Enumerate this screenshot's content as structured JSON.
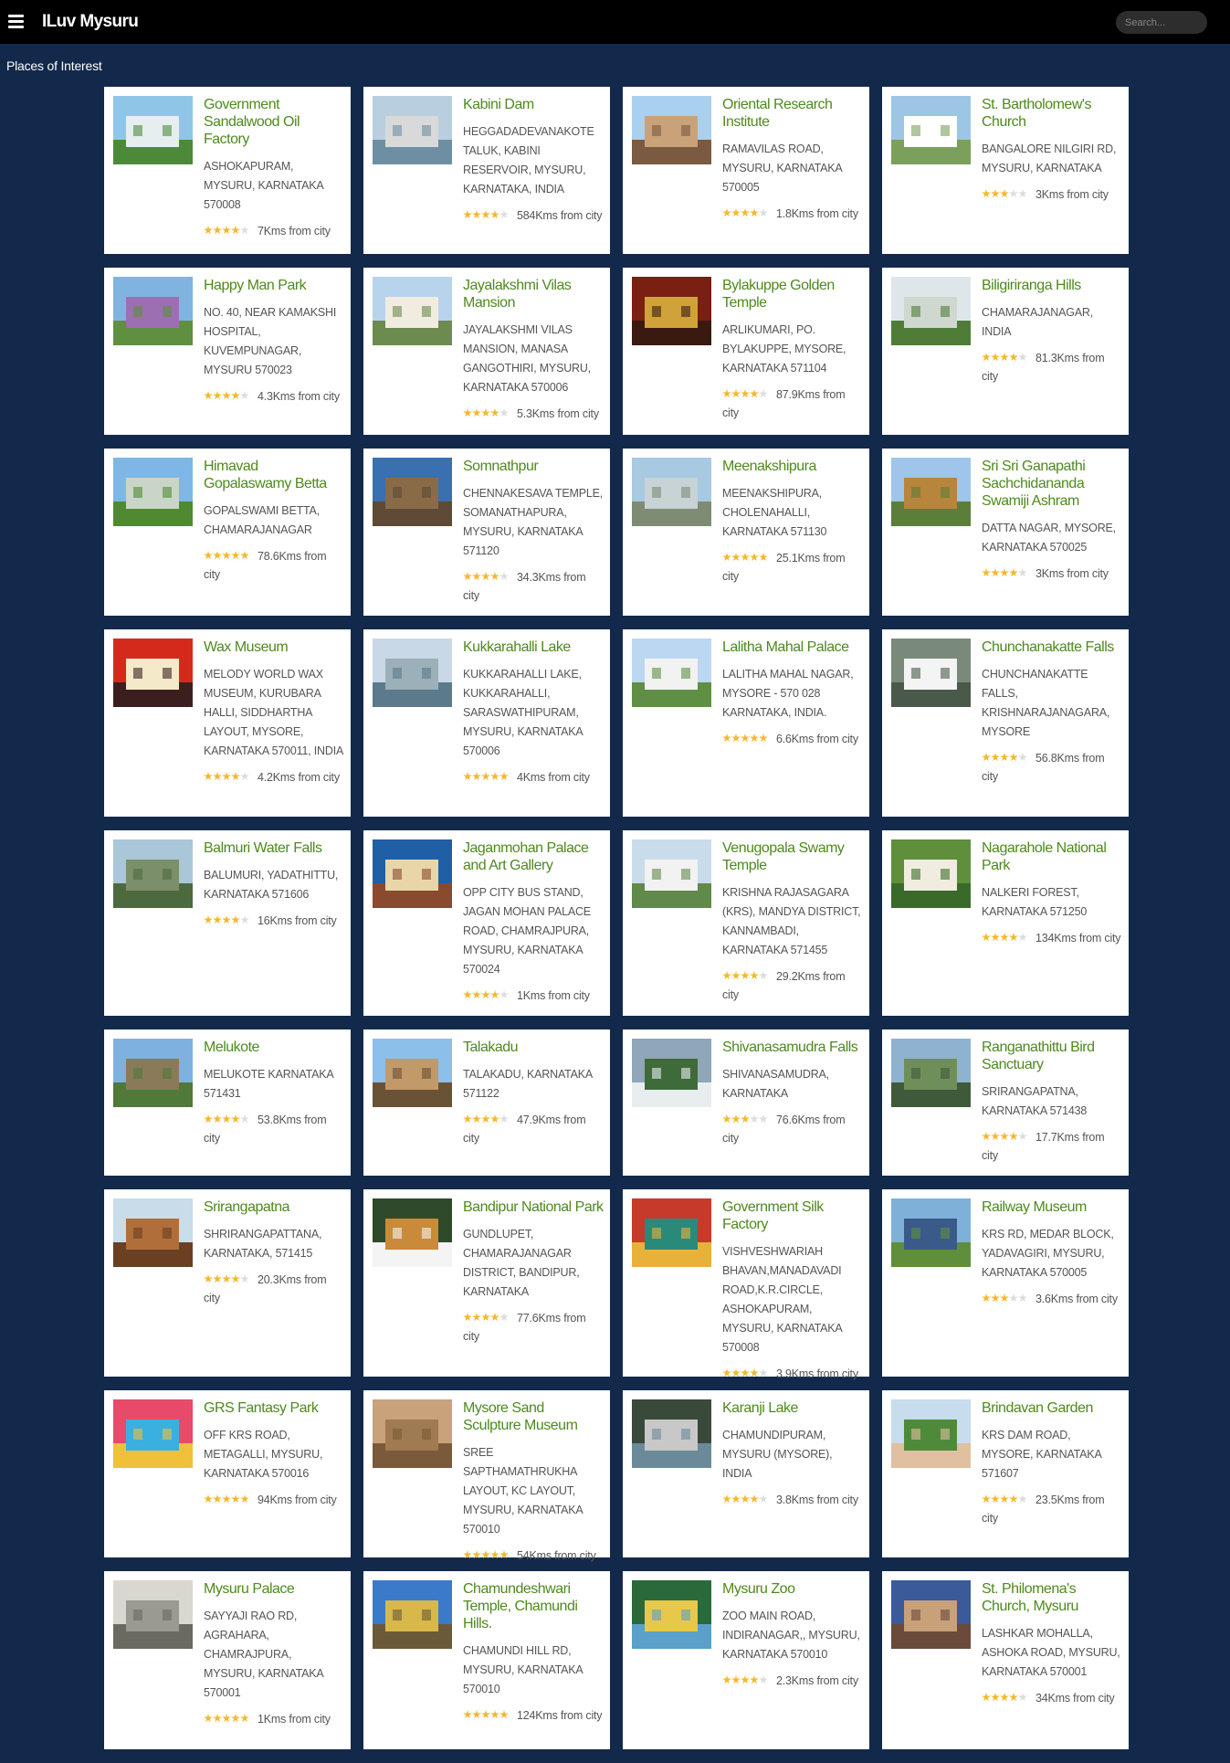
{
  "header": {
    "title": "ILuv Mysuru",
    "search_placeholder": "Search...",
    "menu_icon": "hamburger-menu-icon"
  },
  "section_title": "Places of Interest",
  "colors": {
    "background": "#13294b",
    "topbar": "#000000",
    "place_name": "#4e8a1e",
    "star": "#f5b82e"
  },
  "places": [
    {
      "name": "Government Sandalwood Oil Factory",
      "address": "ASHOKAPURAM, MYSURU, KARNATAKA 570008",
      "rating": 4,
      "distance": "7Kms from city"
    },
    {
      "name": "Kabini Dam",
      "address": "HEGGADADEVANAKOTE TALUK, KABINI RESERVOIR, MYSURU, KARNATAKA, INDIA",
      "rating": 4,
      "distance": "584Kms from city"
    },
    {
      "name": "Oriental Research Institute",
      "address": "RAMAVILAS ROAD, MYSURU, KARNATAKA 570005",
      "rating": 4,
      "distance": "1.8Kms from city"
    },
    {
      "name": "St. Bartholomew's Church",
      "address": "BANGALORE NILGIRI RD, MYSURU, KARNATAKA",
      "rating": 3,
      "distance": "3Kms from city"
    },
    {
      "name": "Happy Man Park",
      "address": "NO. 40, NEAR KAMAKSHI HOSPITAL, KUVEMPUNAGAR, MYSURU 570023",
      "rating": 4,
      "distance": "4.3Kms from city"
    },
    {
      "name": "Jayalakshmi Vilas Mansion",
      "address": "JAYALAKSHMI VILAS MANSION, MANASA GANGOTHIRI, MYSURU, KARNATAKA 570006",
      "rating": 4,
      "distance": "5.3Kms from city"
    },
    {
      "name": "Bylakuppe Golden Temple",
      "address": "ARLIKUMARI, PO. BYLAKUPPE, MYSORE, KARNATAKA 571104",
      "rating": 4,
      "distance": "87.9Kms from city"
    },
    {
      "name": "Biligiriranga Hills",
      "address": "CHAMARAJANAGAR, INDIA",
      "rating": 4,
      "distance": "81.3Kms from city"
    },
    {
      "name": "Himavad Gopalaswamy Betta",
      "address": "GOPALSWAMI BETTA, CHAMARAJANAGAR",
      "rating": 5,
      "distance": "78.6Kms from city"
    },
    {
      "name": "Somnathpur",
      "address": "CHENNAKESAVA TEMPLE, SOMANATHAPURA, MYSURU, KARNATAKA 571120",
      "rating": 4,
      "distance": "34.3Kms from city"
    },
    {
      "name": "Meenakshipura",
      "address": "MEENAKSHIPURA, CHOLENAHALLI, KARNATAKA 571130",
      "rating": 5,
      "distance": "25.1Kms from city"
    },
    {
      "name": "Sri Sri Ganapathi Sachchidananda Swamiji Ashram",
      "address": "DATTA NAGAR, MYSORE, KARNATAKA 570025",
      "rating": 4,
      "distance": "3Kms from city"
    },
    {
      "name": "Wax Museum",
      "address": "MELODY WORLD WAX MUSEUM, KURUBARA HALLI, SIDDHARTHA LAYOUT, MYSORE, KARNATAKA 570011, INDIA",
      "rating": 4,
      "distance": "4.2Kms from city"
    },
    {
      "name": "Kukkarahalli Lake",
      "address": "KUKKARAHALLI LAKE, KUKKARAHALLI, SARASWATHIPURAM, MYSURU, KARNATAKA 570006",
      "rating": 5,
      "distance": "4Kms from city"
    },
    {
      "name": "Lalitha Mahal Palace",
      "address": "LALITHA MAHAL NAGAR, MYSORE - 570 028 KARNATAKA, INDIA.",
      "rating": 5,
      "distance": "6.6Kms from city"
    },
    {
      "name": "Chunchanakatte Falls",
      "address": "CHUNCHANAKATTE FALLS, KRISHNARAJANAGARA, MYSORE",
      "rating": 4,
      "distance": "56.8Kms from city"
    },
    {
      "name": "Balmuri Water Falls",
      "address": "BALUMURI, YADATHITTU, KARNATAKA 571606",
      "rating": 4,
      "distance": "16Kms from city"
    },
    {
      "name": "Jaganmohan Palace and Art Gallery",
      "address": "OPP CITY BUS STAND, JAGAN MOHAN PALACE ROAD, CHAMRAJPURA, MYSURU, KARNATAKA 570024",
      "rating": 4,
      "distance": "1Kms from city"
    },
    {
      "name": "Venugopala Swamy Temple",
      "address": "KRISHNA RAJASAGARA (KRS), MANDYA DISTRICT, KANNAMBADI, KARNATAKA 571455",
      "rating": 4,
      "distance": "29.2Kms from city"
    },
    {
      "name": "Nagarahole National Park",
      "address": "NALKERI FOREST, KARNATAKA 571250",
      "rating": 4,
      "distance": "134Kms from city"
    },
    {
      "name": "Melukote",
      "address": "MELUKOTE KARNATAKA 571431",
      "rating": 4,
      "distance": "53.8Kms from city"
    },
    {
      "name": "Talakadu",
      "address": "TALAKADU, KARNATAKA 571122",
      "rating": 4,
      "distance": "47.9Kms from city"
    },
    {
      "name": "Shivanasamudra Falls",
      "address": "SHIVANASAMUDRA, KARNATAKA",
      "rating": 3,
      "distance": "76.6Kms from city"
    },
    {
      "name": "Ranganathittu Bird Sanctuary",
      "address": "SRIRANGAPATNA, KARNATAKA 571438",
      "rating": 4,
      "distance": "17.7Kms from city"
    },
    {
      "name": "Srirangapatna",
      "address": "SHRIRANGAPATTANA, KARNATAKA, 571415",
      "rating": 4,
      "distance": "20.3Kms from city"
    },
    {
      "name": "Bandipur National Park",
      "address": "GUNDLUPET, CHAMARAJANAGAR DISTRICT, BANDIPUR, KARNATAKA",
      "rating": 4,
      "distance": "77.6Kms from city"
    },
    {
      "name": "Government Silk Factory",
      "address": "VISHVESHWARIAH BHAVAN,MANADAVADI ROAD,K.R.CIRCLE, ASHOKAPURAM, MYSURU, KARNATAKA 570008",
      "rating": 4,
      "distance": "3.9Kms from city"
    },
    {
      "name": "Railway Museum",
      "address": "KRS RD, MEDAR BLOCK, YADAVAGIRI, MYSURU, KARNATAKA 570005",
      "rating": 3,
      "distance": "3.6Kms from city"
    },
    {
      "name": "GRS Fantasy Park",
      "address": "OFF KRS ROAD, METAGALLI, MYSURU, KARNATAKA 570016",
      "rating": 5,
      "distance": "94Kms from city"
    },
    {
      "name": "Mysore Sand Sculpture Museum",
      "address": "SREE SAPTHAMATHRUKHA LAYOUT, KC LAYOUT, MYSURU, KARNATAKA 570010",
      "rating": 5,
      "distance": "54Kms from city"
    },
    {
      "name": "Karanji Lake",
      "address": "CHAMUNDIPURAM, MYSURU (MYSORE), INDIA",
      "rating": 4,
      "distance": "3.8Kms from city"
    },
    {
      "name": "Brindavan Garden",
      "address": "KRS DAM ROAD, MYSORE, KARNATAKA 571607",
      "rating": 4,
      "distance": "23.5Kms from city"
    },
    {
      "name": "Mysuru Palace",
      "address": "SAYYAJI RAO RD, AGRAHARA, CHAMRAJPURA, MYSURU, KARNATAKA 570001",
      "rating": 5,
      "distance": "1Kms from city"
    },
    {
      "name": "Chamundeshwari Temple, Chamundi Hills.",
      "address": "CHAMUNDI HILL RD, MYSURU, KARNATAKA 570010",
      "rating": 5,
      "distance": "124Kms from city"
    },
    {
      "name": "Mysuru Zoo",
      "address": "ZOO MAIN ROAD, INDIRANAGAR,, MYSURU, KARNATAKA 570010",
      "rating": 4,
      "distance": "2.3Kms from city"
    },
    {
      "name": "St. Philomena's Church, Mysuru",
      "address": "LASHKAR MOHALLA, ASHOKA ROAD, MYSURU, KARNATAKA 570001",
      "rating": 4,
      "distance": "34Kms from city"
    }
  ]
}
